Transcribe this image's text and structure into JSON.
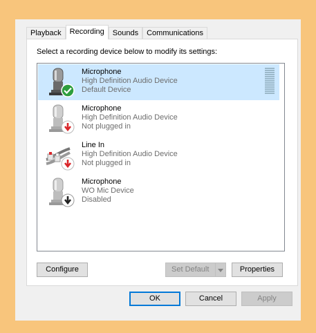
{
  "tabs": [
    {
      "label": "Playback",
      "active": false
    },
    {
      "label": "Recording",
      "active": true
    },
    {
      "label": "Sounds",
      "active": false
    },
    {
      "label": "Communications",
      "active": false
    }
  ],
  "instruction": "Select a recording device below to modify its settings:",
  "devices": [
    {
      "name": "Microphone",
      "driver": "High Definition Audio Device",
      "status": "Default Device",
      "icon": "microphone-icon",
      "badge": "default-check-icon",
      "selected": true,
      "level": 0
    },
    {
      "name": "Microphone",
      "driver": "High Definition Audio Device",
      "status": "Not plugged in",
      "icon": "microphone-icon",
      "badge": "unplugged-red-arrow-icon",
      "selected": false
    },
    {
      "name": "Line In",
      "driver": "High Definition Audio Device",
      "status": "Not plugged in",
      "icon": "rca-cable-icon",
      "badge": "unplugged-red-arrow-icon",
      "selected": false
    },
    {
      "name": "Microphone",
      "driver": "WO Mic Device",
      "status": "Disabled",
      "icon": "microphone-icon",
      "badge": "disabled-arrow-icon",
      "selected": false
    }
  ],
  "buttons": {
    "configure": "Configure",
    "set_default": "Set Default",
    "properties": "Properties",
    "ok": "OK",
    "cancel": "Cancel",
    "apply": "Apply"
  },
  "colors": {
    "background": "#f8c57c",
    "selection": "#cce8ff",
    "default_check": "#2e9e3e",
    "unplugged": "#d9262a",
    "focus": "#0078d7"
  }
}
